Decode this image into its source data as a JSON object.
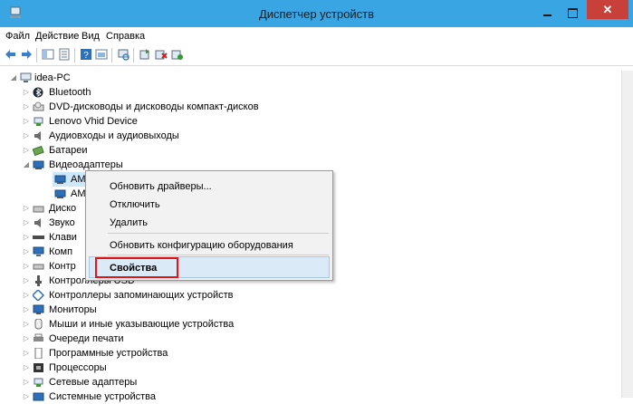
{
  "window": {
    "title": "Диспетчер устройств",
    "close_glyph": "✕",
    "accent": "#3aa5e3",
    "close_color": "#c7413a"
  },
  "menu": [
    "Файл",
    "Действие",
    "Вид",
    "Справка"
  ],
  "toolbar_icons": [
    "back-icon",
    "forward-icon",
    "view-icon",
    "properties-icon",
    "help-icon",
    "show-icon",
    "scan-icon",
    "update-driver-icon",
    "uninstall-icon",
    "disable-icon"
  ],
  "tree": {
    "root": "idea-PC",
    "items": [
      {
        "label": "Bluetooth"
      },
      {
        "label": "DVD-дисководы и дисководы компакт-дисков"
      },
      {
        "label": "Lenovo Vhid Device"
      },
      {
        "label": "Аудиовходы и аудиовыходы"
      },
      {
        "label": "Батареи"
      },
      {
        "label": "Видеоадаптеры"
      },
      {
        "label": "AM"
      },
      {
        "label": "AM"
      },
      {
        "label": "Диско"
      },
      {
        "label": "Звуко"
      },
      {
        "label": "Клави"
      },
      {
        "label": "Комп"
      },
      {
        "label": "Контр"
      },
      {
        "label": "Контроллеры USB"
      },
      {
        "label": "Контроллеры запоминающих устройств"
      },
      {
        "label": "Мониторы"
      },
      {
        "label": "Мыши и иные указывающие устройства"
      },
      {
        "label": "Очереди печати"
      },
      {
        "label": "Программные устройства"
      },
      {
        "label": "Процессоры"
      },
      {
        "label": "Сетевые адаптеры"
      },
      {
        "label": "Системные устройства"
      }
    ]
  },
  "context_menu": {
    "update_drivers": "Обновить драйверы...",
    "disable": "Отключить",
    "uninstall": "Удалить",
    "scan": "Обновить конфигурацию оборудования",
    "properties": "Свойства",
    "highlight_color": "#e2141b"
  }
}
